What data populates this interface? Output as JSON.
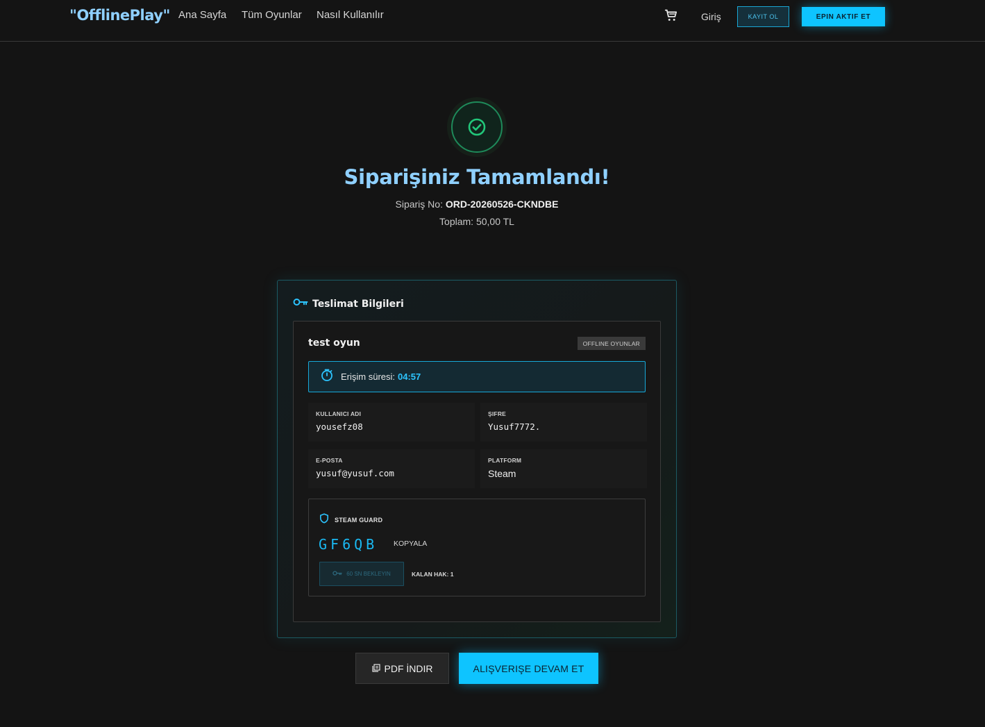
{
  "header": {
    "logo": "\"OfflinePlay\"",
    "nav": [
      "Ana Sayfa",
      "Tüm Oyunlar",
      "Nasıl Kullanılır"
    ],
    "login": "Giriş",
    "register": "KAYIT OL",
    "epin": "EPIN AKTIF ET",
    "cart_icon": "cart-icon"
  },
  "success": {
    "title": "Siparişiniz Tamamlandı!",
    "order_label": "Sipariş No:",
    "order_no": "ORD-20260526-CKNDBE",
    "total": "Toplam: 50,00 TL",
    "icon": "check-circle-icon"
  },
  "delivery": {
    "title": "Teslimat Bilgileri",
    "item": {
      "name": "test oyun",
      "category": "OFFLINE OYUNLAR",
      "timer_label": "Erişim süresi:",
      "timer_value": "04:57",
      "fields": {
        "username_label": "KULLANICI ADI",
        "username": "yousefz08",
        "password_label": "ŞIFRE",
        "password": "Yusuf7772.",
        "email_label": "E-POSTA",
        "email": "yusuf@yusuf.com",
        "platform_label": "PLATFORM",
        "platform": "Steam"
      },
      "guard": {
        "title": "STEAM GUARD",
        "code": "GF6QB",
        "copy": "KOPYALA",
        "wait": "60 SN BEKLEYIN",
        "remaining": "KALAN HAK: 1"
      }
    }
  },
  "actions": {
    "pdf": "PDF İNDIR",
    "continue": "ALIŞVERIŞE DEVAM ET"
  },
  "colors": {
    "accent": "#0ec4ff",
    "title": "#8fd0ff",
    "success": "#22c77a",
    "background": "#141414"
  }
}
